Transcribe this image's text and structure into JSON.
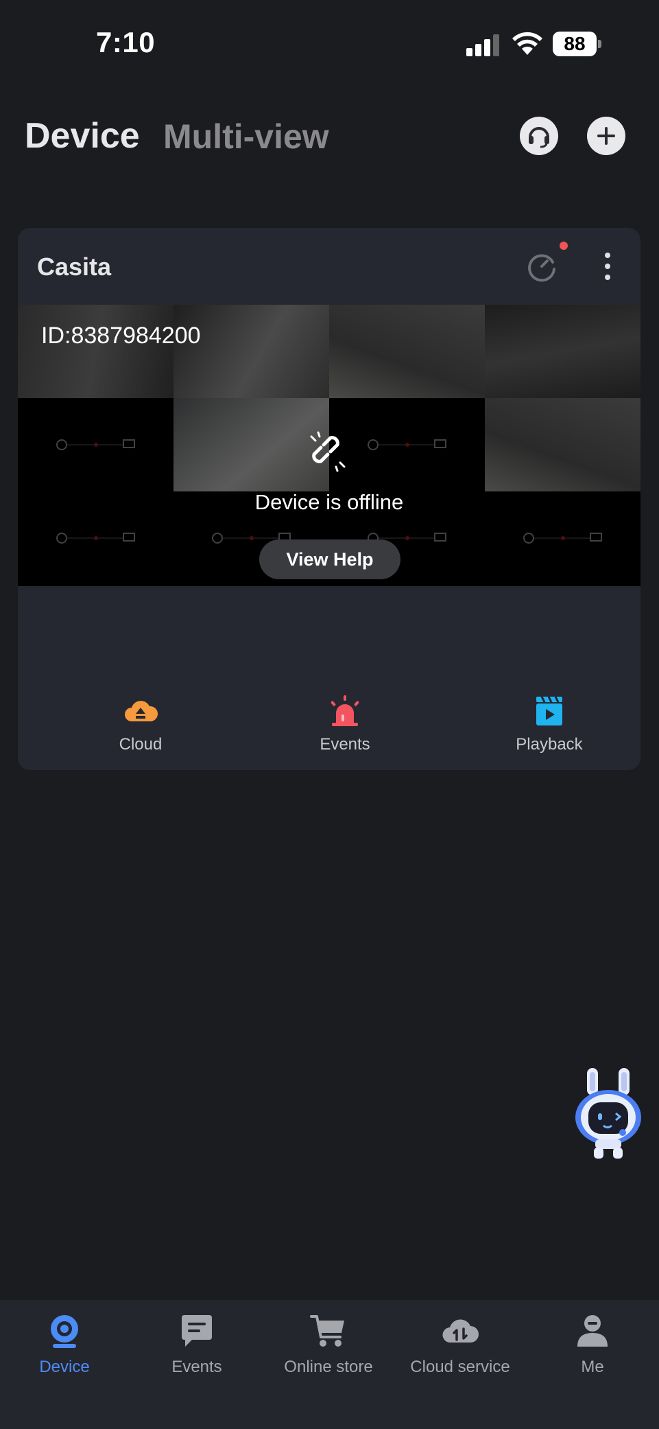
{
  "status_bar": {
    "time": "7:10",
    "battery": "88"
  },
  "header": {
    "tabs": [
      {
        "label": "Device",
        "active": true
      },
      {
        "label": "Multi-view",
        "active": false
      }
    ],
    "icons": [
      "headset-icon",
      "add-icon"
    ]
  },
  "device_card": {
    "name": "Casita",
    "device_id": "ID:8387984200",
    "offline_message": "Device is offline",
    "help_button": "View Help",
    "actions": [
      {
        "label": "Cloud",
        "icon": "cloud-upload-icon",
        "color": "#f59a3d"
      },
      {
        "label": "Events",
        "icon": "alarm-siren-icon",
        "color": "#f25560"
      },
      {
        "label": "Playback",
        "icon": "video-playback-icon",
        "color": "#1fb3f0"
      }
    ]
  },
  "bottom_nav": {
    "items": [
      {
        "label": "Device",
        "icon": "camera-icon",
        "active": true
      },
      {
        "label": "Events",
        "icon": "message-icon",
        "active": false
      },
      {
        "label": "Online store",
        "icon": "cart-icon",
        "active": false
      },
      {
        "label": "Cloud service",
        "icon": "cloud-service-icon",
        "active": false
      },
      {
        "label": "Me",
        "icon": "user-icon",
        "active": false
      }
    ]
  },
  "colors": {
    "background": "#1b1c20",
    "card": "#262831",
    "accent": "#4b8cf6"
  }
}
